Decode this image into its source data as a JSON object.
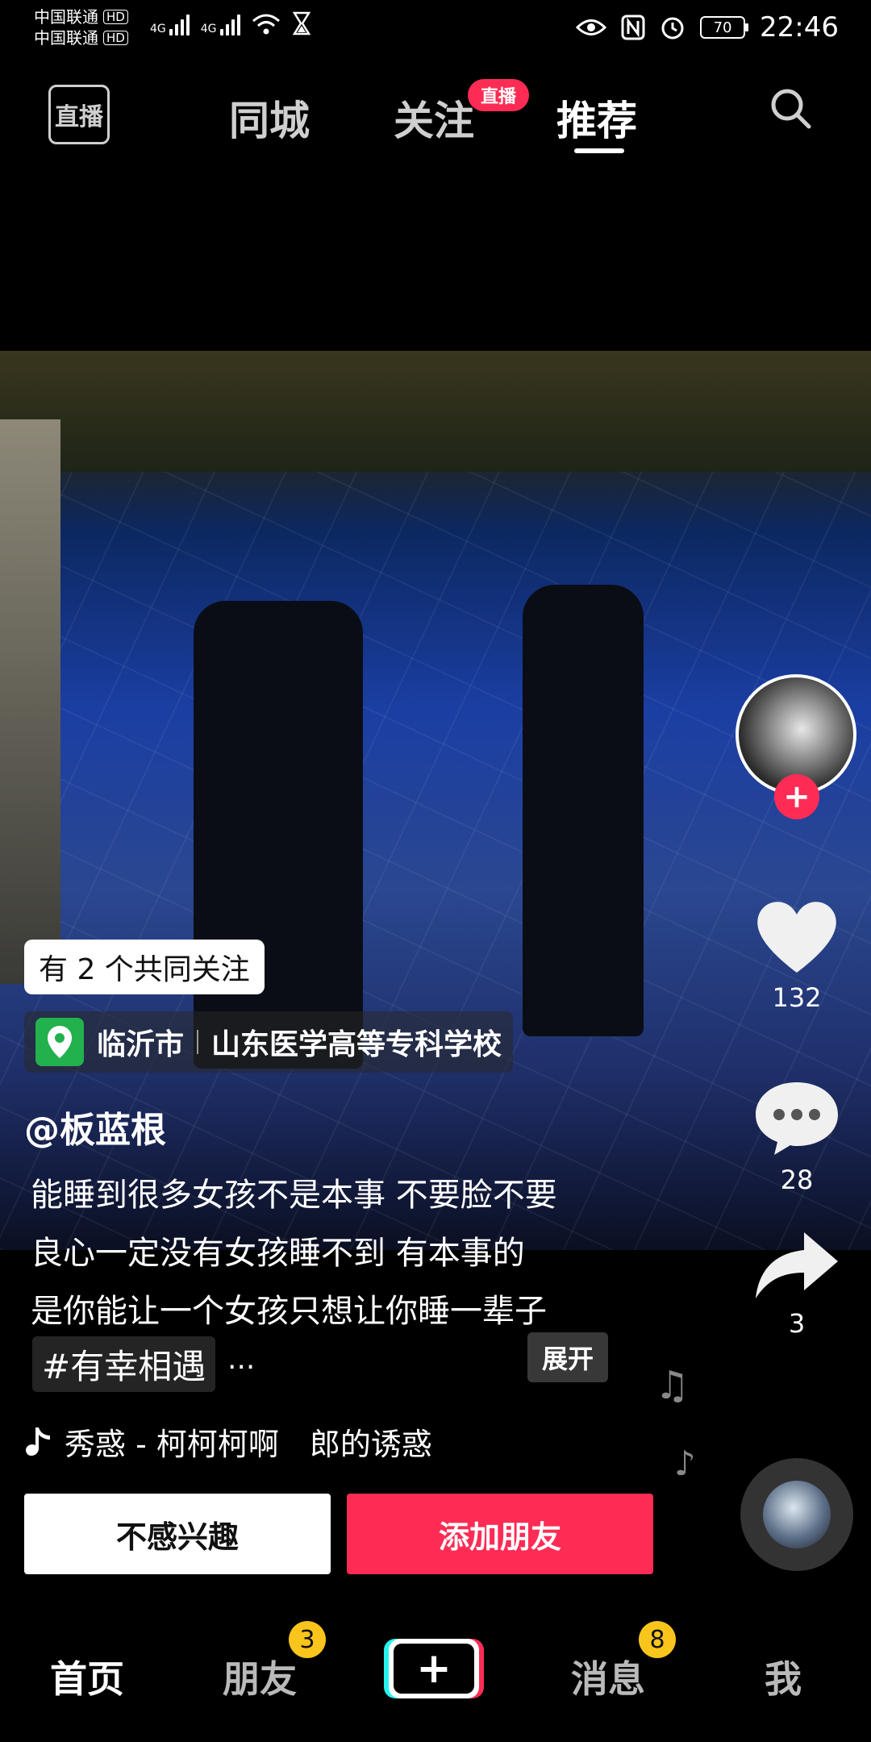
{
  "status_bar": {
    "carrier1": "中国联通",
    "carrier2": "中国联通",
    "hd": "HD",
    "network1": "4G",
    "network2": "4G",
    "battery": "70",
    "time": "22:46"
  },
  "top_nav": {
    "live_label": "直播",
    "tabs": [
      {
        "label": "同城"
      },
      {
        "label": "关注"
      },
      {
        "label": "推荐"
      }
    ],
    "live_badge": "直播",
    "active_tab": "推荐"
  },
  "right_rail": {
    "like_count": "132",
    "comment_count": "28",
    "share_count": "3"
  },
  "caption": {
    "mutual_follow": "有 2 个共同关注",
    "location_city": "临沂市",
    "location_place": "山东医学高等专科学校",
    "username": "@板蓝根",
    "lines": [
      "能睡到很多女孩不是本事 不要脸不要",
      "良心一定没有女孩睡不到 有本事的",
      "是你能让一个女孩只想让你睡一辈子"
    ],
    "hashtag": "#有幸相遇",
    "ellipsis": "...",
    "expand_label": "展开",
    "music": "秀惑 - 柯柯柯啊　郎的诱惑"
  },
  "actions": {
    "not_interested": "不感兴趣",
    "add_friend": "添加朋友"
  },
  "bottom_nav": {
    "home": "首页",
    "friends": "朋友",
    "friends_badge": "3",
    "plus": "+",
    "messages": "消息",
    "messages_badge": "8",
    "me": "我"
  },
  "colors": {
    "accent": "#fe2c55",
    "badge": "#f9c51c",
    "location_pin": "#23b14d"
  }
}
